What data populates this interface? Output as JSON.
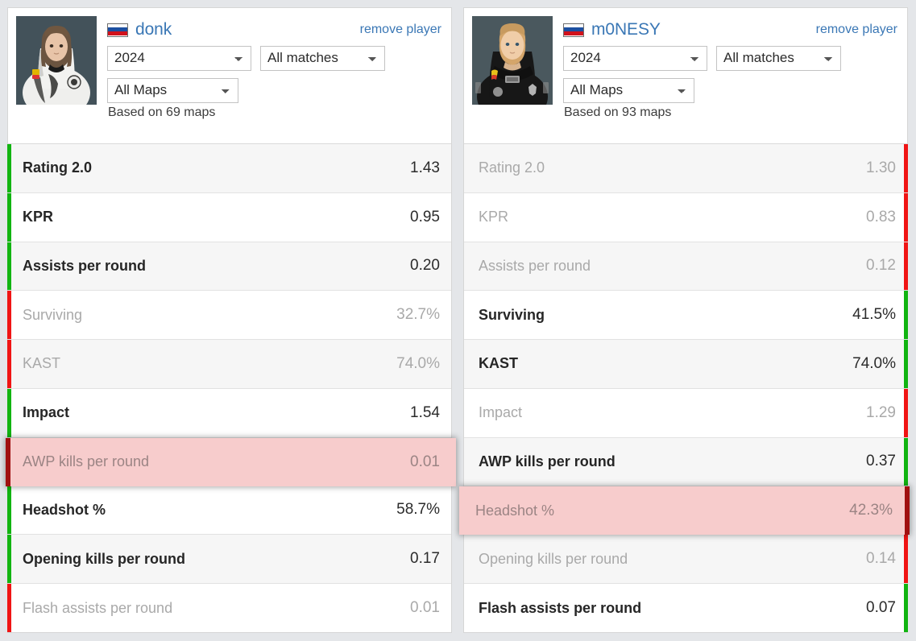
{
  "background_color": "#e4e6e9",
  "accent_link_color": "#3a77b5",
  "colors": {
    "better": "#11b411",
    "worse": "#f01414",
    "highlight_bg": "#f7cccc",
    "highlight_bar": "#a01010"
  },
  "players": [
    {
      "name": "donk",
      "country": "Russia",
      "flag_icon": "russia-flag-icon",
      "remove_label": "remove player",
      "filters": {
        "year": {
          "value": "2024",
          "options": [
            "2024"
          ]
        },
        "matches": {
          "value": "All matches",
          "options": [
            "All matches"
          ]
        },
        "maps": {
          "value": "All Maps",
          "options": [
            "All Maps"
          ]
        }
      },
      "based_on": "Based on 69 maps",
      "stats": [
        {
          "label": "Rating 2.0",
          "value": "1.43",
          "better": true,
          "alt": true,
          "highlight": false
        },
        {
          "label": "KPR",
          "value": "0.95",
          "better": true,
          "alt": false,
          "highlight": false
        },
        {
          "label": "Assists per round",
          "value": "0.20",
          "better": true,
          "alt": true,
          "highlight": false
        },
        {
          "label": "Surviving",
          "value": "32.7%",
          "better": false,
          "alt": false,
          "highlight": false
        },
        {
          "label": "KAST",
          "value": "74.0%",
          "better": false,
          "alt": true,
          "highlight": false
        },
        {
          "label": "Impact",
          "value": "1.54",
          "better": true,
          "alt": false,
          "highlight": false
        },
        {
          "label": "AWP kills per round",
          "value": "0.01",
          "better": false,
          "alt": true,
          "highlight": true
        },
        {
          "label": "Headshot %",
          "value": "58.7%",
          "better": true,
          "alt": false,
          "highlight": false
        },
        {
          "label": "Opening kills per round",
          "value": "0.17",
          "better": true,
          "alt": true,
          "highlight": false
        },
        {
          "label": "Flash assists per round",
          "value": "0.01",
          "better": false,
          "alt": false,
          "highlight": false
        }
      ]
    },
    {
      "name": "m0NESY",
      "country": "Russia",
      "flag_icon": "russia-flag-icon",
      "remove_label": "remove player",
      "filters": {
        "year": {
          "value": "2024",
          "options": [
            "2024"
          ]
        },
        "matches": {
          "value": "All matches",
          "options": [
            "All matches"
          ]
        },
        "maps": {
          "value": "All Maps",
          "options": [
            "All Maps"
          ]
        }
      },
      "based_on": "Based on 93 maps",
      "stats": [
        {
          "label": "Rating 2.0",
          "value": "1.30",
          "better": false,
          "alt": true,
          "highlight": false
        },
        {
          "label": "KPR",
          "value": "0.83",
          "better": false,
          "alt": false,
          "highlight": false
        },
        {
          "label": "Assists per round",
          "value": "0.12",
          "better": false,
          "alt": true,
          "highlight": false
        },
        {
          "label": "Surviving",
          "value": "41.5%",
          "better": true,
          "alt": false,
          "highlight": false
        },
        {
          "label": "KAST",
          "value": "74.0%",
          "better": true,
          "alt": true,
          "highlight": false
        },
        {
          "label": "Impact",
          "value": "1.29",
          "better": false,
          "alt": false,
          "highlight": false
        },
        {
          "label": "AWP kills per round",
          "value": "0.37",
          "better": true,
          "alt": true,
          "highlight": false
        },
        {
          "label": "Headshot %",
          "value": "42.3%",
          "better": false,
          "alt": false,
          "highlight": true
        },
        {
          "label": "Opening kills per round",
          "value": "0.14",
          "better": false,
          "alt": true,
          "highlight": false
        },
        {
          "label": "Flash assists per round",
          "value": "0.07",
          "better": true,
          "alt": false,
          "highlight": false
        }
      ]
    }
  ]
}
